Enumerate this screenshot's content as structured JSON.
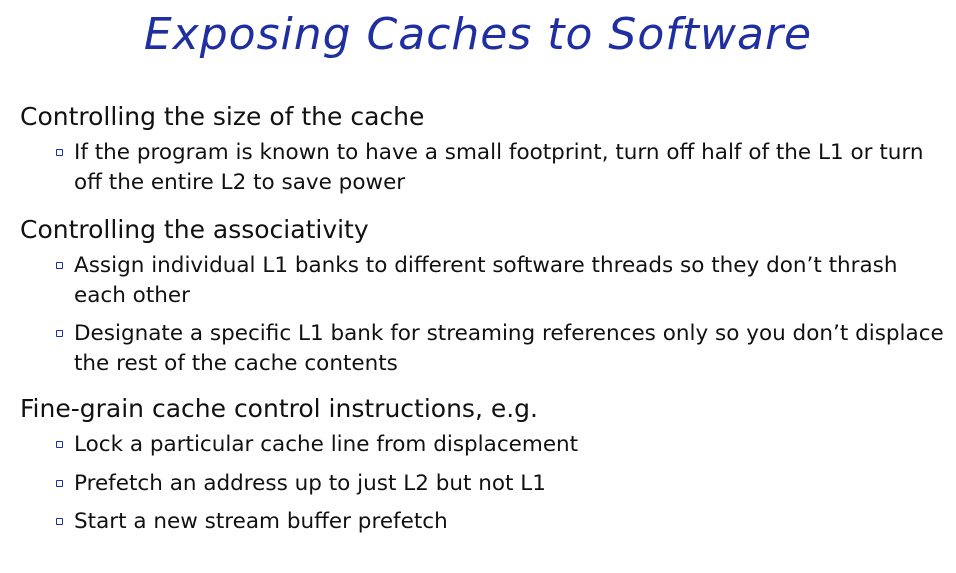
{
  "title": "Exposing Caches to Software",
  "sections": [
    {
      "heading": "Controlling the size of the cache",
      "bullets": [
        "If the program is known to have a small footprint, turn off half of the L1 or turn off the entire L2 to save power"
      ]
    },
    {
      "heading": "Controlling the associativity",
      "bullets": [
        "Assign individual L1 banks to different software threads so they don’t thrash each other",
        "Designate a specific L1 bank for streaming references only so you don’t displace the rest of the cache contents"
      ]
    },
    {
      "heading": "Fine-grain cache control instructions, e.g.",
      "bullets": [
        "Lock a particular cache line from displacement",
        "Prefetch an address up to just L2 but not L1",
        "Start a new stream buffer prefetch"
      ]
    }
  ],
  "colors": {
    "title": "#1f2ea0",
    "bullet_marker": "#1f2ea0",
    "text": "#111111"
  }
}
